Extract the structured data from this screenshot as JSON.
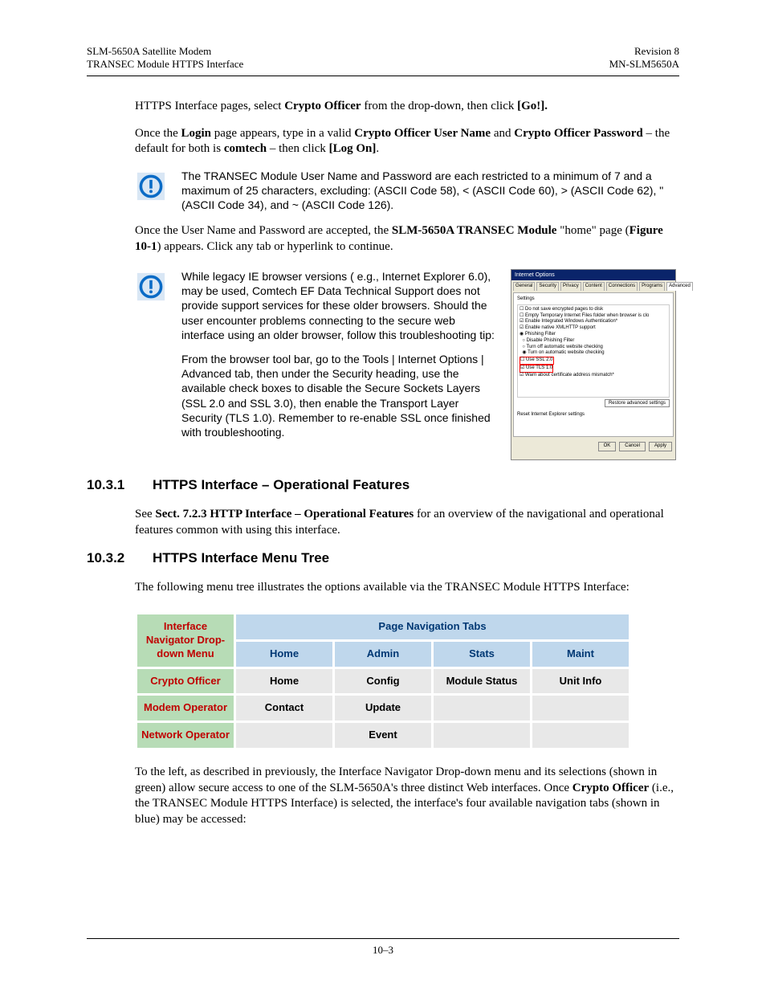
{
  "header": {
    "left1": "SLM-5650A Satellite Modem",
    "left2": "TRANSEC Module HTTPS Interface",
    "right1": "Revision 8",
    "right2": "MN-SLM5650A"
  },
  "intro": {
    "p1_a": "HTTPS Interface pages, select ",
    "p1_b": "Crypto Officer",
    "p1_c": " from the drop-down, then click ",
    "p1_d": "[Go!].",
    "p2_a": "Once the ",
    "p2_b": "Login",
    "p2_c": " page appears, type in a valid ",
    "p2_d": "Crypto Officer User Name",
    "p2_e": " and ",
    "p2_f": "Crypto Officer Password",
    "p2_g": " – the default for both is ",
    "p2_h": "comtech",
    "p2_i": " – then click ",
    "p2_j": "[Log On]",
    "p2_k": "."
  },
  "note1": "The TRANSEC Module User Name and Password are each restricted to a minimum of 7 and a maximum of 25 characters, excluding: (ASCII Code 58), < (ASCII Code 60), > (ASCII Code 62), \" (ASCII Code 34), and ~ (ASCII Code 126).",
  "p3_a": "Once the User Name and Password are accepted, the ",
  "p3_b": "SLM-5650A TRANSEC Module",
  "p3_c": " \"home\" page (",
  "p3_d": "Figure 10-1",
  "p3_e": ") appears. Click any tab or hyperlink to continue.",
  "note2a": "While legacy IE browser versions ( e.g., Internet Explorer 6.0), may be used, Comtech EF Data Technical Support does not provide support services for these older browsers. Should the user encounter problems connecting to the secure web interface using an older browser, follow this troubleshooting tip:",
  "note2b": "From the browser tool bar, go to the Tools | Internet Options | Advanced tab, then under the Security heading, use the available check boxes to disable the Secure Sockets Layers (SSL 2.0 and SSL 3.0), then enable the Transport Layer Security (TLS 1.0). Remember to re-enable SSL once finished with troubleshooting.",
  "dialog": {
    "title": "Internet Options",
    "tabs": [
      "General",
      "Security",
      "Privacy",
      "Content",
      "Connections",
      "Programs",
      "Advanced"
    ],
    "group": "Settings",
    "btn_ok": "OK",
    "btn_cancel": "Cancel",
    "btn_apply": "Apply"
  },
  "sec1": {
    "num": "10.3.1",
    "title": "HTTPS Interface – Operational Features"
  },
  "sec1_p_a": "See ",
  "sec1_p_b": "Sect. 7.2.3 HTTP Interface – Operational Features",
  "sec1_p_c": " for an overview of the navigational and operational features common with using this interface.",
  "sec2": {
    "num": "10.3.2",
    "title": "HTTPS Interface Menu Tree"
  },
  "sec2_p": "The following menu tree illustrates the options available via the TRANSEC Module HTTPS Interface:",
  "tbl": {
    "nav_header": "Interface Navigator Drop-down Menu",
    "tabs_header": "Page Navigation Tabs",
    "cols": [
      "Home",
      "Admin",
      "Stats",
      "Maint"
    ],
    "rows": [
      {
        "nav": "Crypto Officer",
        "cells": [
          "Home",
          "Config",
          "Module Status",
          "Unit Info"
        ]
      },
      {
        "nav": "Modem Operator",
        "cells": [
          "Contact",
          "Update",
          "",
          ""
        ]
      },
      {
        "nav": "Network Operator",
        "cells": [
          "",
          "Event",
          "",
          ""
        ]
      }
    ]
  },
  "closing_a": "To the left, as described in previously, the Interface Navigator Drop-down menu and its selections (shown in green) allow secure access to one of the SLM-5650A's three distinct Web interfaces. Once ",
  "closing_b": "Crypto Officer",
  "closing_c": " (i.e., the TRANSEC Module HTTPS Interface) is selected, the interface's four available navigation tabs (shown in blue) may be accessed:",
  "footer": "10–3"
}
